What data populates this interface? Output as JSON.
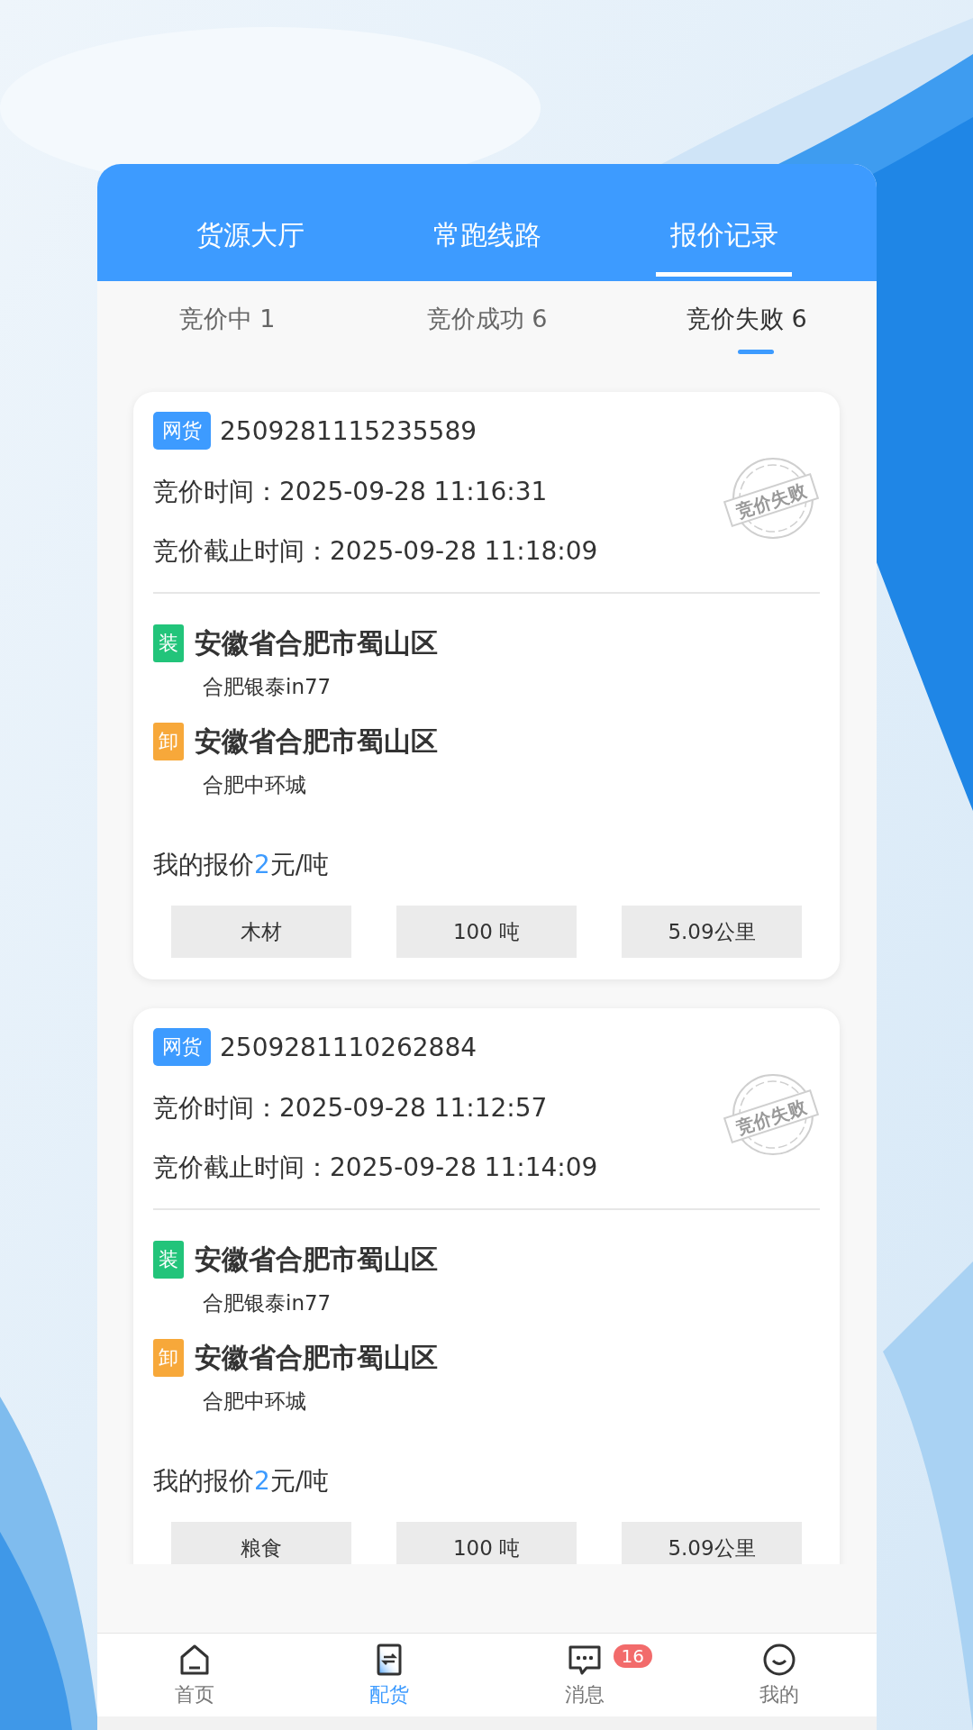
{
  "top_tabs": [
    {
      "label": "货源大厅",
      "selected": false
    },
    {
      "label": "常跑线路",
      "selected": false
    },
    {
      "label": "报价记录",
      "selected": true
    }
  ],
  "sub_tabs": [
    {
      "label": "竞价中 1",
      "selected": false
    },
    {
      "label": "竞价成功 6",
      "selected": false
    },
    {
      "label": "竞价失败 6",
      "selected": true
    }
  ],
  "orders": [
    {
      "tag": "网货",
      "number": "2509281115235589",
      "bid_time_label": "竞价时间：",
      "bid_time": "2025-09-28 11:16:31",
      "deadline_label": "竞价截止时间：",
      "deadline": "2025-09-28 11:18:09",
      "stamp": "竞价失败",
      "stops": [
        {
          "kind": "load",
          "badge": "装",
          "address": "安徽省合肥市蜀山区",
          "detail": "合肥银泰in77"
        },
        {
          "kind": "unload",
          "badge": "卸",
          "address": "安徽省合肥市蜀山区",
          "detail": "合肥中环城"
        }
      ],
      "price": {
        "label": "我的报价",
        "amount": "2",
        "unit": "元/吨"
      },
      "chips": [
        "木材",
        "100 吨",
        "5.09公里"
      ]
    },
    {
      "tag": "网货",
      "number": "2509281110262884",
      "bid_time_label": "竞价时间：",
      "bid_time": "2025-09-28 11:12:57",
      "deadline_label": "竞价截止时间：",
      "deadline": "2025-09-28 11:14:09",
      "stamp": "竞价失败",
      "stops": [
        {
          "kind": "load",
          "badge": "装",
          "address": "安徽省合肥市蜀山区",
          "detail": "合肥银泰in77"
        },
        {
          "kind": "unload",
          "badge": "卸",
          "address": "安徽省合肥市蜀山区",
          "detail": "合肥中环城"
        }
      ],
      "price": {
        "label": "我的报价",
        "amount": "2",
        "unit": "元/吨"
      },
      "chips": [
        "粮食",
        "100 吨",
        "5.09公里"
      ]
    }
  ],
  "bottom_nav": [
    {
      "label": "首页",
      "kind": "home",
      "selected": false
    },
    {
      "label": "配货",
      "kind": "dispatch",
      "selected": true
    },
    {
      "label": "消息",
      "kind": "message",
      "selected": false,
      "badge": "16"
    },
    {
      "label": "我的",
      "kind": "mine",
      "selected": false
    }
  ]
}
